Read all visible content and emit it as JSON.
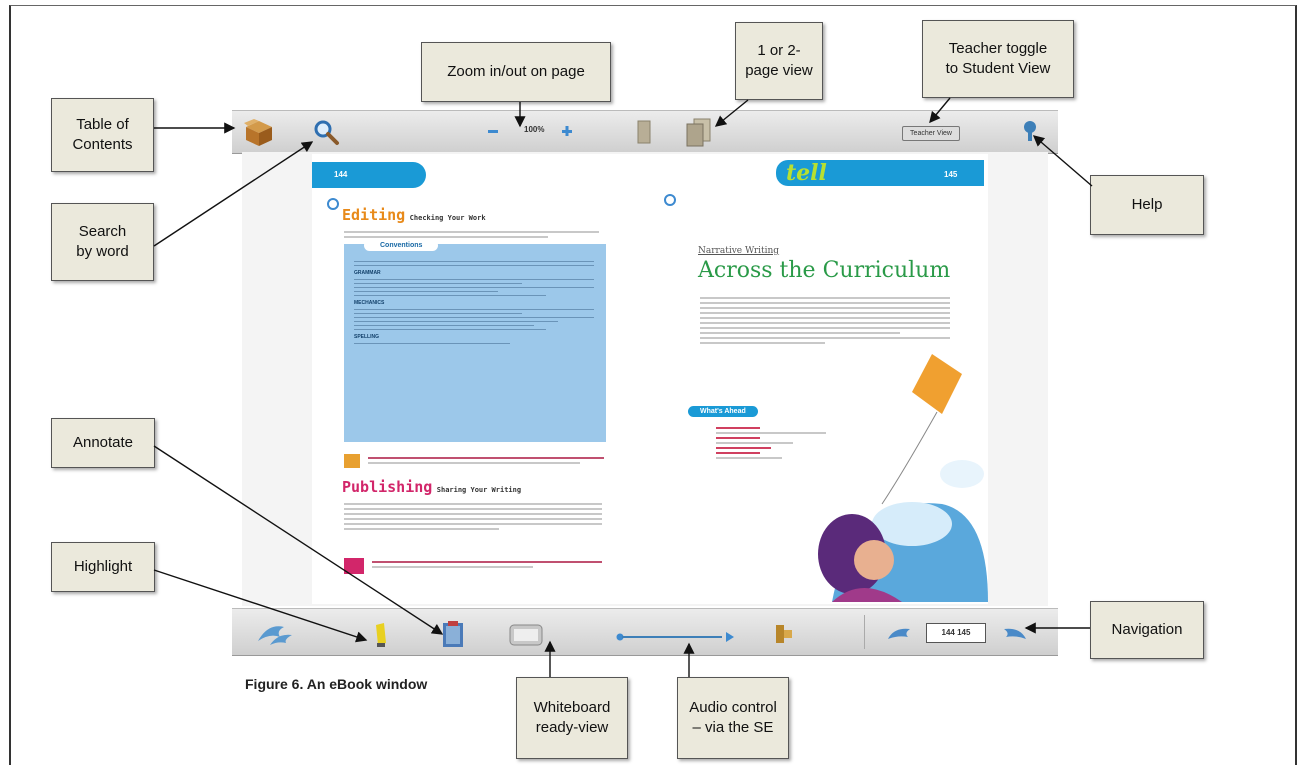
{
  "callouts": {
    "zoom": "Zoom in/out on page",
    "page_view": "1  or 2-\npage view",
    "teacher_toggle": "Teacher toggle\nto Student View",
    "toc": "Table of\nContents",
    "search": "Search\nby word",
    "help": "Help",
    "annotate": "Annotate",
    "highlight": "Highlight",
    "navigation": "Navigation",
    "whiteboard": "Whiteboard\nready-view",
    "audio": "Audio control\n– via the SE"
  },
  "toolbar": {
    "zoom_level": "100%",
    "teacher_button": "Teacher View",
    "page_box": "144 145"
  },
  "book": {
    "left_page_number": "144",
    "right_page_number": "145",
    "editing_title": "Editing",
    "editing_subtitle": "Checking Your Work",
    "conventions": "Conventions",
    "sec_grammar": "GRAMMAR",
    "sec_mechanics": "MECHANICS",
    "sec_spelling": "SPELLING",
    "publishing_title": "Publishing",
    "publishing_subtitle": "Sharing Your Writing",
    "right_kicker": "Narrative Writing",
    "right_title": "Across the Curriculum",
    "whats_ahead": "What's Ahead",
    "brand": "tell"
  },
  "caption": "Figure 6. An eBook window",
  "colors": {
    "callout_bg": "#ebe9dc",
    "banner_blue": "#1a9ad6",
    "panel_blue": "#9cc8ea",
    "editing_orange": "#e88a1a",
    "publishing_pink": "#d2266a",
    "curriculum_green": "#2a9a48"
  }
}
